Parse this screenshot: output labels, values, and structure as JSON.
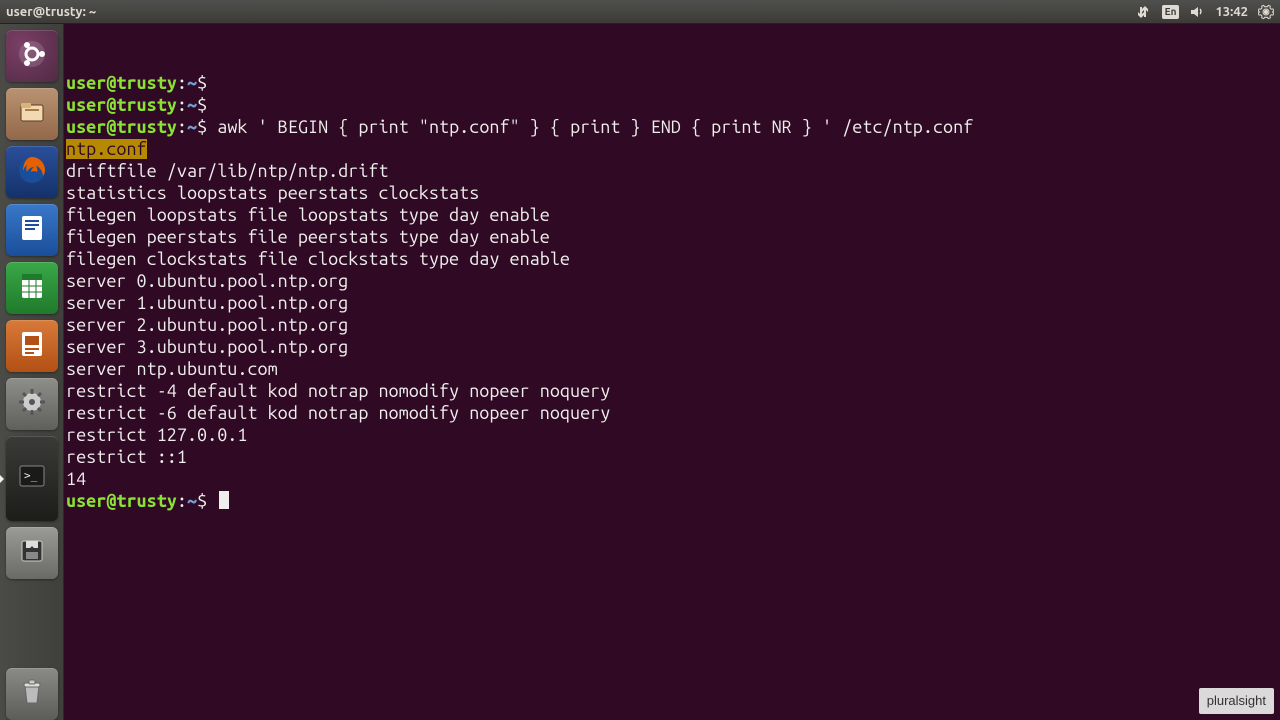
{
  "panel": {
    "title": "user@trusty: ~",
    "lang": "En",
    "clock": "13:42"
  },
  "launcher": {
    "items": [
      {
        "name": "ubuntu-dash",
        "kind": "ubuntu"
      },
      {
        "name": "files",
        "kind": "files"
      },
      {
        "name": "firefox",
        "kind": "firefox"
      },
      {
        "name": "writer",
        "kind": "writer"
      },
      {
        "name": "calc",
        "kind": "calc"
      },
      {
        "name": "impress",
        "kind": "impress"
      },
      {
        "name": "settings",
        "kind": "settings"
      },
      {
        "name": "terminal",
        "kind": "terminal",
        "active": true
      },
      {
        "name": "save-media",
        "kind": "save"
      }
    ],
    "trash": {
      "name": "trash",
      "kind": "trash"
    }
  },
  "terminal": {
    "prompt_user": "user@trusty",
    "prompt_sep": ":",
    "prompt_path": "~",
    "prompt_end": "$",
    "lines": [
      {
        "type": "prompt",
        "cmd": ""
      },
      {
        "type": "prompt",
        "cmd": ""
      },
      {
        "type": "prompt",
        "cmd": "awk ' BEGIN { print \"ntp.conf\" } { print } END { print NR } ' /etc/ntp.conf"
      },
      {
        "type": "out-hl",
        "text": "ntp.conf"
      },
      {
        "type": "out",
        "text": "driftfile /var/lib/ntp/ntp.drift"
      },
      {
        "type": "out",
        "text": "statistics loopstats peerstats clockstats"
      },
      {
        "type": "out",
        "text": "filegen loopstats file loopstats type day enable"
      },
      {
        "type": "out",
        "text": "filegen peerstats file peerstats type day enable"
      },
      {
        "type": "out",
        "text": "filegen clockstats file clockstats type day enable"
      },
      {
        "type": "out",
        "text": "server 0.ubuntu.pool.ntp.org"
      },
      {
        "type": "out",
        "text": "server 1.ubuntu.pool.ntp.org"
      },
      {
        "type": "out",
        "text": "server 2.ubuntu.pool.ntp.org"
      },
      {
        "type": "out",
        "text": "server 3.ubuntu.pool.ntp.org"
      },
      {
        "type": "out",
        "text": "server ntp.ubuntu.com"
      },
      {
        "type": "out",
        "text": "restrict -4 default kod notrap nomodify nopeer noquery"
      },
      {
        "type": "out",
        "text": "restrict -6 default kod notrap nomodify nopeer noquery"
      },
      {
        "type": "out",
        "text": "restrict 127.0.0.1"
      },
      {
        "type": "out",
        "text": "restrict ::1"
      },
      {
        "type": "out",
        "text": "14"
      },
      {
        "type": "prompt-cursor",
        "cmd": ""
      }
    ]
  },
  "watermark": "pluralsight"
}
